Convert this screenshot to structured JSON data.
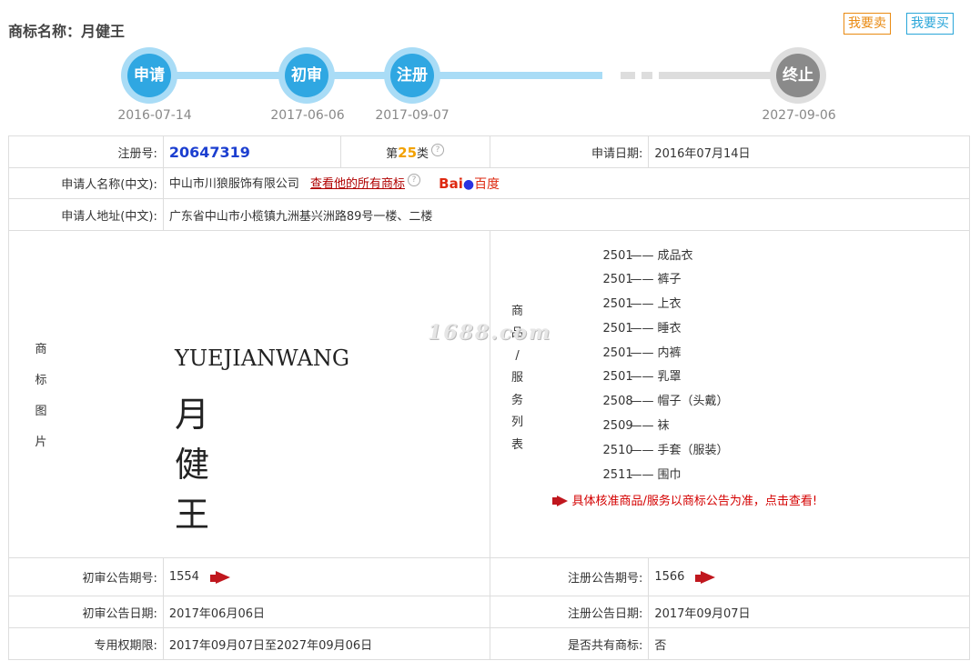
{
  "header": {
    "title_label": "商标名称：",
    "title_value": "月健王",
    "sell_button": "我要卖",
    "buy_button": "我要买"
  },
  "timeline": {
    "steps": [
      {
        "label": "申请",
        "date": "2016-07-14"
      },
      {
        "label": "初审",
        "date": "2017-06-06"
      },
      {
        "label": "注册",
        "date": "2017-09-07"
      },
      {
        "label": "终止",
        "date": "2027-09-06"
      }
    ]
  },
  "info": {
    "reg_no_label": "注册号:",
    "reg_no": "20647319",
    "class_prefix": "第",
    "class_num": "25",
    "class_suffix": "类",
    "apply_date_label": "申请日期:",
    "apply_date": "2016年07月14日",
    "applicant_label": "申请人名称(中文):",
    "applicant": "中山市川狼服饰有限公司",
    "applicant_link": "查看他的所有商标",
    "baidu_text": "Bai",
    "baidu_cn": "百度",
    "address_label": "申请人地址(中文):",
    "address": "广东省中山市小榄镇九洲基兴洲路89号一楼、二楼",
    "image_label": [
      "商",
      "标",
      "图",
      "片"
    ],
    "trademark_en": "YUEJIANWANG",
    "trademark_cn": "月健王",
    "watermark": "1688.com",
    "goods_label": [
      "商",
      "品",
      "/",
      "服",
      "务",
      "列",
      "表"
    ],
    "goods": [
      {
        "code": "2501",
        "name": "成品衣"
      },
      {
        "code": "2501",
        "name": "裤子"
      },
      {
        "code": "2501",
        "name": "上衣"
      },
      {
        "code": "2501",
        "name": "睡衣"
      },
      {
        "code": "2501",
        "name": "内裤"
      },
      {
        "code": "2501",
        "name": "乳罩"
      },
      {
        "code": "2508",
        "name": "帽子（头戴）"
      },
      {
        "code": "2509",
        "name": "袜"
      },
      {
        "code": "2510",
        "name": "手套（服装）"
      },
      {
        "code": "2511",
        "name": "围巾"
      }
    ],
    "goods_notice": "具体核准商品/服务以商标公告为准，点击查看!",
    "prelim_no_label": "初审公告期号:",
    "prelim_no": "1554",
    "reg_pub_no_label": "注册公告期号:",
    "reg_pub_no": "1566",
    "prelim_date_label": "初审公告日期:",
    "prelim_date": "2017年06月06日",
    "reg_pub_date_label": "注册公告日期:",
    "reg_pub_date": "2017年09月07日",
    "term_label": "专用权期限:",
    "term": "2017年09月07日至2027年09月06日",
    "shared_label": "是否共有商标:",
    "shared": "否"
  },
  "colors": {
    "active_node": "#2fa7e2",
    "end_node": "#8a8a8a",
    "reg_no": "#1c3fd0",
    "class_num": "#f2a100",
    "notice": "#d40000"
  }
}
